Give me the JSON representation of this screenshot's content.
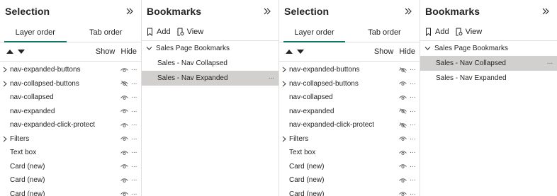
{
  "panes": [
    {
      "title": "Selection",
      "tabs": [
        {
          "label": "Layer order",
          "active": true
        },
        {
          "label": "Tab order",
          "active": false
        }
      ],
      "show_label": "Show",
      "hide_label": "Hide",
      "layers": [
        {
          "name": "nav-expanded-buttons",
          "expandable": true,
          "visible": true
        },
        {
          "name": "nav-collapsed-buttons",
          "expandable": true,
          "visible": false
        },
        {
          "name": "nav-collapsed",
          "expandable": false,
          "visible": true
        },
        {
          "name": "nav-expanded",
          "expandable": false,
          "visible": true
        },
        {
          "name": "nav-expanded-click-protect",
          "expandable": false,
          "visible": true
        },
        {
          "name": "Filters",
          "expandable": true,
          "visible": true
        },
        {
          "name": "Text box",
          "expandable": false,
          "visible": true
        },
        {
          "name": "Card (new)",
          "expandable": false,
          "visible": true
        },
        {
          "name": "Card (new)",
          "expandable": false,
          "visible": true
        },
        {
          "name": "Card (new)",
          "expandable": false,
          "visible": true
        }
      ]
    },
    {
      "title": "Bookmarks",
      "add_label": "Add",
      "view_label": "View",
      "group_label": "Sales Page Bookmarks",
      "items": [
        {
          "label": "Sales - Nav Collapsed",
          "selected": false
        },
        {
          "label": "Sales - Nav Expanded",
          "selected": true
        }
      ]
    },
    {
      "title": "Selection",
      "tabs": [
        {
          "label": "Layer order",
          "active": true
        },
        {
          "label": "Tab order",
          "active": false
        }
      ],
      "show_label": "Show",
      "hide_label": "Hide",
      "layers": [
        {
          "name": "nav-expanded-buttons",
          "expandable": true,
          "visible": false
        },
        {
          "name": "nav-collapsed-buttons",
          "expandable": true,
          "visible": true
        },
        {
          "name": "nav-collapsed",
          "expandable": false,
          "visible": true
        },
        {
          "name": "nav-expanded",
          "expandable": false,
          "visible": false
        },
        {
          "name": "nav-expanded-click-protect",
          "expandable": false,
          "visible": false
        },
        {
          "name": "Filters",
          "expandable": true,
          "visible": true
        },
        {
          "name": "Text box",
          "expandable": false,
          "visible": true
        },
        {
          "name": "Card (new)",
          "expandable": false,
          "visible": true
        },
        {
          "name": "Card (new)",
          "expandable": false,
          "visible": true
        },
        {
          "name": "Card (new)",
          "expandable": false,
          "visible": true
        }
      ]
    },
    {
      "title": "Bookmarks",
      "add_label": "Add",
      "view_label": "View",
      "group_label": "Sales Page Bookmarks",
      "items": [
        {
          "label": "Sales - Nav Collapsed",
          "selected": true
        },
        {
          "label": "Sales - Nav Expanded",
          "selected": false
        }
      ]
    }
  ],
  "more_glyph": "···",
  "colors": {
    "accent": "#117865",
    "selected_bg": "#d2d0ce",
    "divider": "#e1dfdd",
    "icon": "#605e5c",
    "text": "#252423"
  },
  "icons": {
    "collapse": "double-chevron-right-icon",
    "move_up": "triangle-up-icon",
    "move_down": "triangle-down-icon",
    "expand": "chevron-right-icon",
    "group_expand": "chevron-down-icon",
    "visible": "eye-icon",
    "hidden": "eye-hidden-icon",
    "add": "bookmark-add-icon",
    "view": "view-icon",
    "more": "more-options-icon"
  }
}
